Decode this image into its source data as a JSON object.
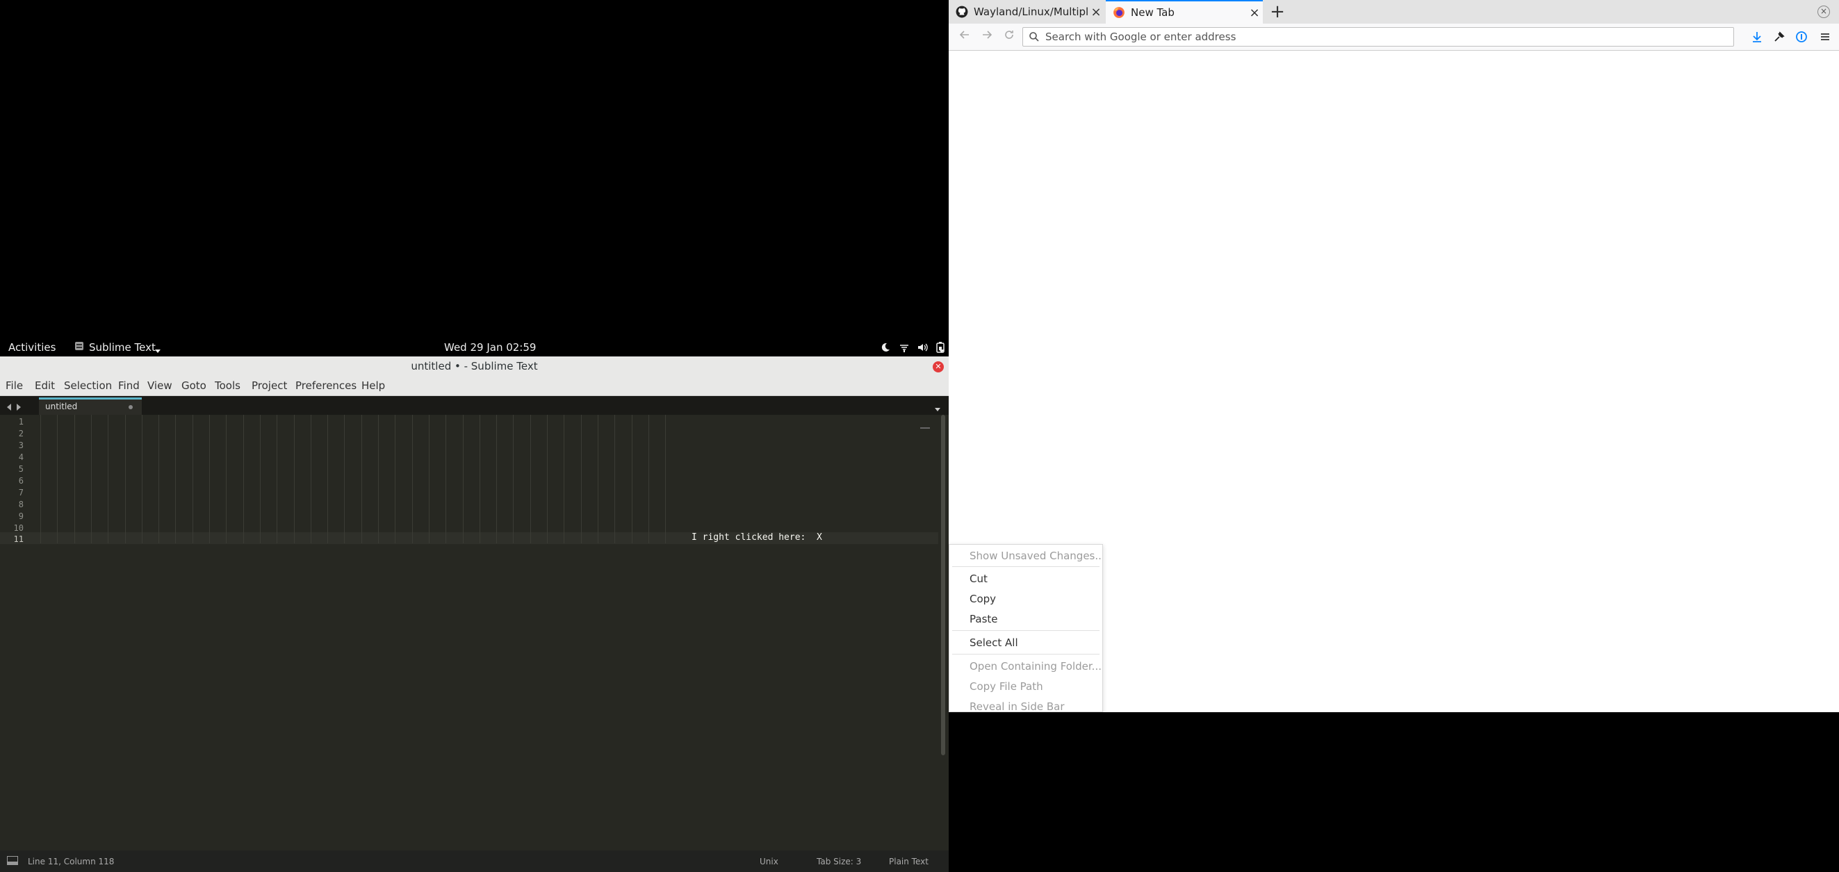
{
  "firefox": {
    "tabs": [
      {
        "title": "Wayland/Linux/Multiple",
        "active": false
      },
      {
        "title": "New Tab",
        "active": true
      }
    ],
    "new_tab_symbol": "+",
    "close_symbol": "×",
    "url_placeholder": "Search with Google or enter address",
    "icons": [
      "back-icon",
      "forward-icon",
      "reload-icon",
      "search-icon",
      "download-icon",
      "extension-icon",
      "password-manager-icon",
      "hamburger-menu-icon",
      "github-icon",
      "firefox-icon"
    ],
    "accent_color": "#0a84ff"
  },
  "gnome": {
    "activities": "Activities",
    "app_menu": "Sublime Text",
    "clock": "Wed 29 Jan  02:59",
    "icons": [
      "night-light-icon",
      "network-icon",
      "volume-icon",
      "battery-icon",
      "system-menu-arrow-icon"
    ]
  },
  "sublime": {
    "title": "untitled • - Sublime Text",
    "menu": [
      "File",
      "Edit",
      "Selection",
      "Find",
      "View",
      "Goto",
      "Tools",
      "Project",
      "Preferences",
      "Help"
    ],
    "tab_title": "untitled",
    "line_numbers": [
      "1",
      "2",
      "3",
      "4",
      "5",
      "6",
      "7",
      "8",
      "9",
      "10",
      "11"
    ],
    "line11_text": "I right clicked here:  X",
    "status": {
      "position": "Line 11, Column 118",
      "line_endings": "Unix",
      "tab_size": "Tab Size: 3",
      "syntax": "Plain Text"
    },
    "colors": {
      "background": "#272822",
      "tab_accent": "#5ab4c8",
      "close_button": "#e33b3b"
    }
  },
  "context_menu": {
    "items": [
      {
        "label": "Show Unsaved Changes...",
        "enabled": false
      },
      {
        "label": "Cut",
        "enabled": true
      },
      {
        "label": "Copy",
        "enabled": true
      },
      {
        "label": "Paste",
        "enabled": true
      },
      {
        "label": "Select All",
        "enabled": true
      },
      {
        "label": "Open Containing Folder...",
        "enabled": false
      },
      {
        "label": "Copy File Path",
        "enabled": false
      },
      {
        "label": "Reveal in Side Bar",
        "enabled": false
      }
    ]
  }
}
